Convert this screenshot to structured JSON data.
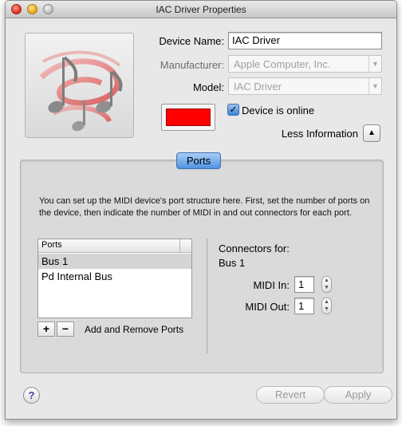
{
  "window": {
    "title": "IAC Driver Properties"
  },
  "icon": {
    "name": "music-notes-icon"
  },
  "fields": {
    "device_name_label": "Device Name:",
    "device_name_value": "IAC Driver",
    "manufacturer_label": "Manufacturer:",
    "manufacturer_value": "Apple Computer, Inc.",
    "model_label": "Model:",
    "model_value": "IAC Driver"
  },
  "device_color": "#ff0000",
  "online": {
    "label": "Device is online",
    "checked": true,
    "check_glyph": "✓"
  },
  "less_info": {
    "label": "Less Information",
    "glyph": "▲"
  },
  "ports_section": {
    "tab_label": "Ports",
    "description": "You can set up the MIDI device's port structure here.  First, set the number of ports on the device, then indicate the number of MIDI in and out connectors for each port.",
    "table_header": "Ports",
    "rows": [
      "Bus 1",
      "Pd Internal Bus"
    ],
    "selected_row": 0,
    "add_glyph": "+",
    "remove_glyph": "−",
    "add_remove_label": "Add and Remove Ports"
  },
  "connectors": {
    "title": "Connectors for:",
    "port_name": "Bus 1",
    "midi_in_label": "MIDI In:",
    "midi_in_value": "1",
    "midi_out_label": "MIDI Out:",
    "midi_out_value": "1",
    "stepper_up": "▲",
    "stepper_down": "▼"
  },
  "footer": {
    "help_glyph": "?",
    "revert_label": "Revert",
    "apply_label": "Apply"
  }
}
